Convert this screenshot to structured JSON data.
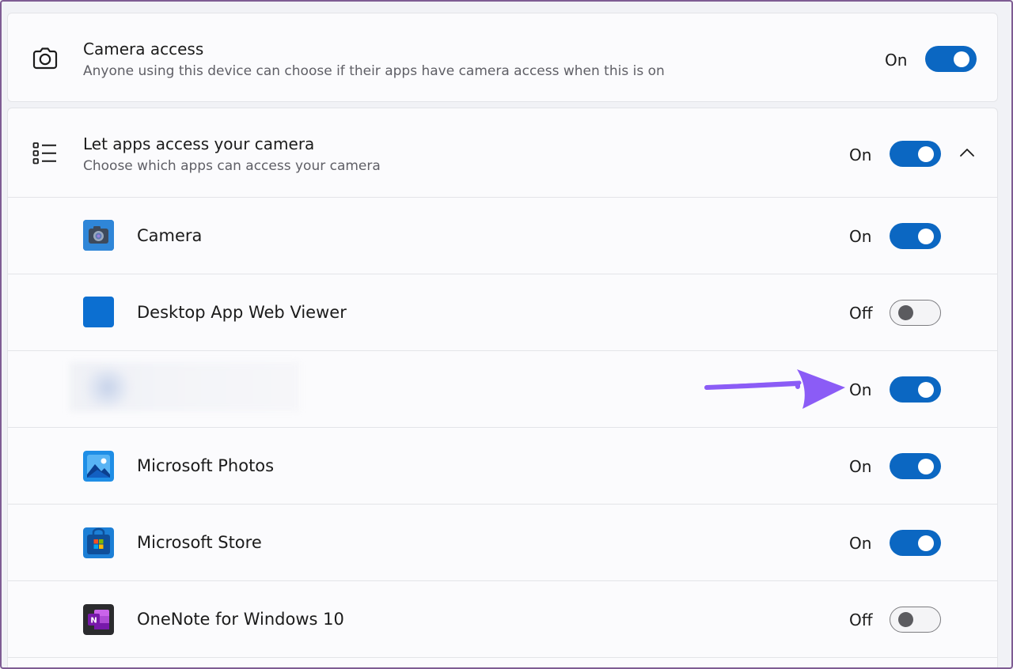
{
  "camera_access": {
    "title": "Camera access",
    "subtitle": "Anyone using this device can choose if their apps have camera access when this is on",
    "state": "On",
    "on": true
  },
  "let_apps": {
    "title": "Let apps access your camera",
    "subtitle": "Choose which apps can access your camera",
    "state": "On",
    "on": true,
    "expanded": true
  },
  "apps": [
    {
      "name": "Camera",
      "state": "On",
      "on": true,
      "icon": "camera-app-icon"
    },
    {
      "name": "Desktop App Web Viewer",
      "state": "Off",
      "on": false,
      "icon": "web-viewer-app-icon"
    },
    {
      "name": "",
      "state": "On",
      "on": true,
      "icon": "blurred-app-icon"
    },
    {
      "name": "Microsoft Photos",
      "state": "On",
      "on": true,
      "icon": "photos-app-icon"
    },
    {
      "name": "Microsoft Store",
      "state": "On",
      "on": true,
      "icon": "store-app-icon"
    },
    {
      "name": "OneNote for Windows 10",
      "state": "Off",
      "on": false,
      "icon": "onenote-app-icon"
    }
  ],
  "colors": {
    "accent": "#0b67c2",
    "annotation_arrow": "#8b5cf6"
  }
}
